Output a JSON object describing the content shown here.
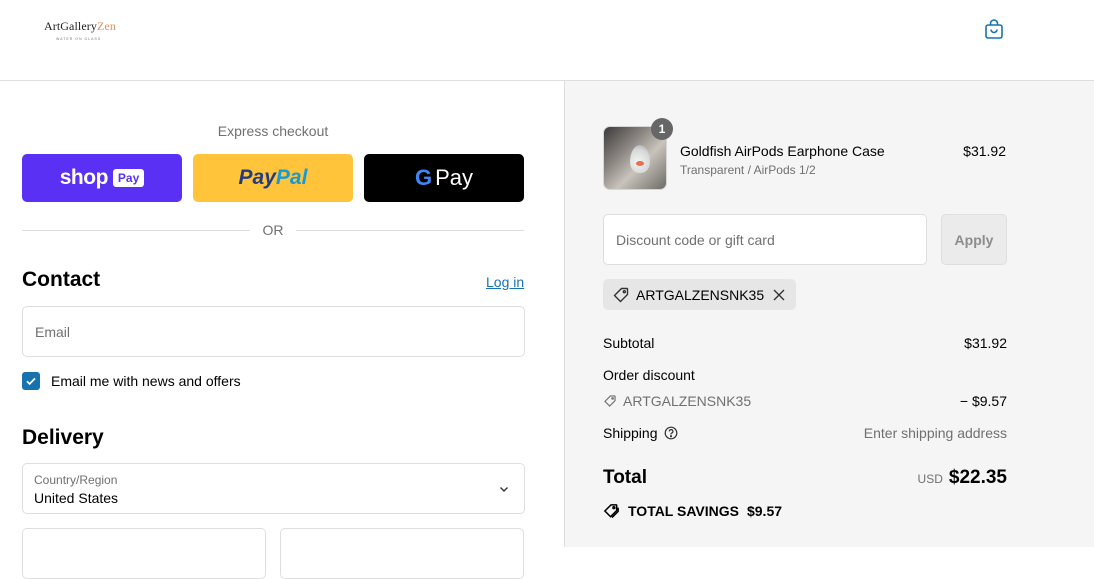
{
  "header": {
    "logo_main": "ArtGallery",
    "logo_accent": "Zen",
    "logo_sub": "WATER ON GLASS",
    "cart_icon": "shopping-bag-icon"
  },
  "express": {
    "title": "Express checkout",
    "shop_pay": {
      "word": "shop",
      "tag": "Pay"
    },
    "paypal": {
      "part1": "Pay",
      "part2": "Pal"
    },
    "gpay": {
      "g": "G",
      "word": "Pay"
    },
    "or": "OR"
  },
  "contact": {
    "title": "Contact",
    "login": "Log in",
    "email_placeholder": "Email",
    "newsletter_label": "Email me with news and offers",
    "newsletter_checked": true
  },
  "delivery": {
    "title": "Delivery",
    "country_label": "Country/Region",
    "country_value": "United States"
  },
  "order": {
    "item": {
      "name": "Goldfish AirPods Earphone Case",
      "variant": "Transparent / AirPods 1/2",
      "price": "$31.92",
      "quantity": "1"
    },
    "discount_placeholder": "Discount code or gift card",
    "apply_label": "Apply",
    "applied_code": "ARTGALZENSNK35",
    "subtotal_label": "Subtotal",
    "subtotal_value": "$31.92",
    "order_discount_label": "Order discount",
    "discount_code": "ARTGALZENSNK35",
    "discount_value": "− $9.57",
    "shipping_label": "Shipping",
    "shipping_value": "Enter shipping address",
    "total_label": "Total",
    "currency": "USD",
    "total_value": "$22.35",
    "savings_label": "TOTAL SAVINGS",
    "savings_value": "$9.57"
  },
  "colors": {
    "shop_pay": "#5a31f4",
    "paypal": "#ffc439",
    "link": "#1773b0",
    "summary_bg": "#f5f5f5"
  }
}
